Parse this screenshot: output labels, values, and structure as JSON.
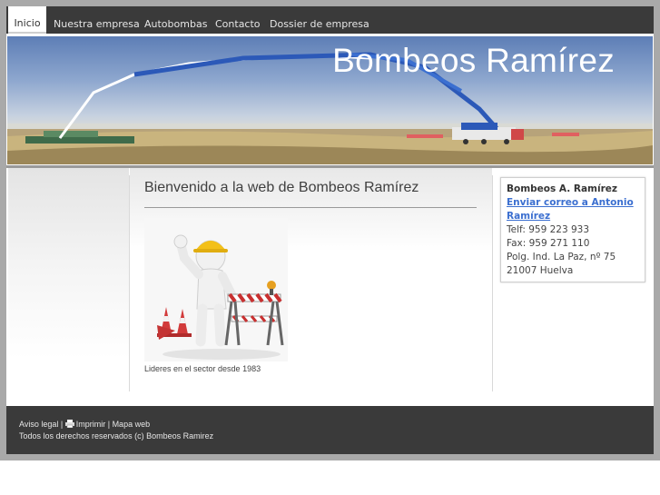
{
  "nav": {
    "items": [
      {
        "label": "Inicio",
        "active": true
      },
      {
        "label": "Nuestra empresa"
      },
      {
        "label": "Autobombas"
      },
      {
        "label": "Contacto"
      },
      {
        "label": "Dossier de empresa"
      }
    ]
  },
  "banner": {
    "title": "Bombeos Ramírez",
    "image": "concrete-pump-truck-photo"
  },
  "main": {
    "heading": "Bienvenido a la web de Bombeos Ramírez",
    "image": "construction-worker-figure-with-barrier",
    "caption": "Lideres en el sector desde 1983"
  },
  "contact": {
    "name": "Bombeos A. Ramírez",
    "email_link_line1": "Enviar correo a Antonio",
    "email_link_line2": "Ramírez",
    "phone": "Telf: 959 223 933",
    "fax": "Fax: 959 271 110",
    "address": "Polg. Ind. La Paz, nº 75",
    "city": "21007  Huelva"
  },
  "footer": {
    "aviso": "Aviso legal",
    "sep1": " | ",
    "imprimir": "Imprimir",
    "sep2": " | ",
    "mapa": "Mapa web",
    "rights": "Todos los derechos reservados (c) Bombeos Ramirez"
  },
  "colors": {
    "nav_bg": "#3a3a3a",
    "link": "#3b6fd0",
    "frame": "#a9a9a9"
  }
}
